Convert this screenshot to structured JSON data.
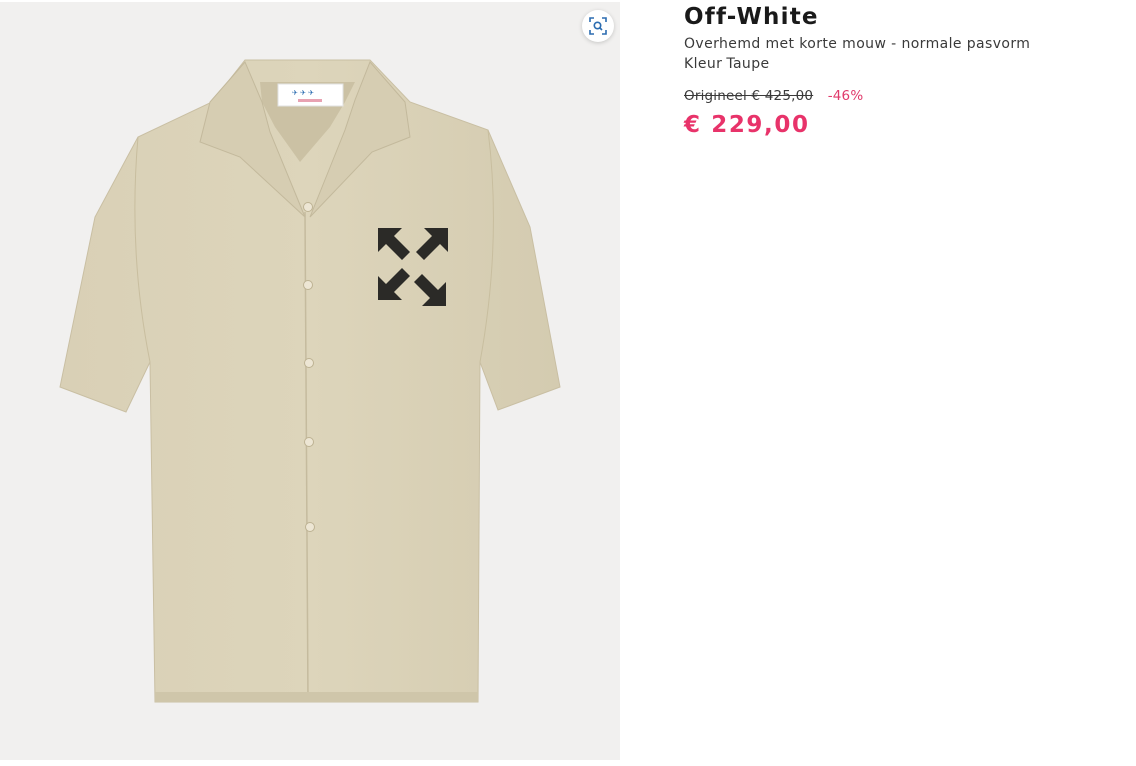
{
  "product": {
    "brand": "Off-White",
    "title": "Overhemd met korte mouw - normale pasvorm",
    "color_label": "Kleur",
    "color_value": "Taupe",
    "original_price": "Origineel € 425,00",
    "discount": "-46%",
    "price": "€ 229,00"
  },
  "gallery": {
    "image_subject": "shirt-image",
    "visual_search_icon": "visual-search-icon"
  },
  "colors": {
    "price": "#e8336a",
    "discount": "#e03a6b",
    "gallery_bg": "#f1f0ef",
    "shirt": "#d8cfb4",
    "visual_search_icon": "#2b6cb0"
  }
}
